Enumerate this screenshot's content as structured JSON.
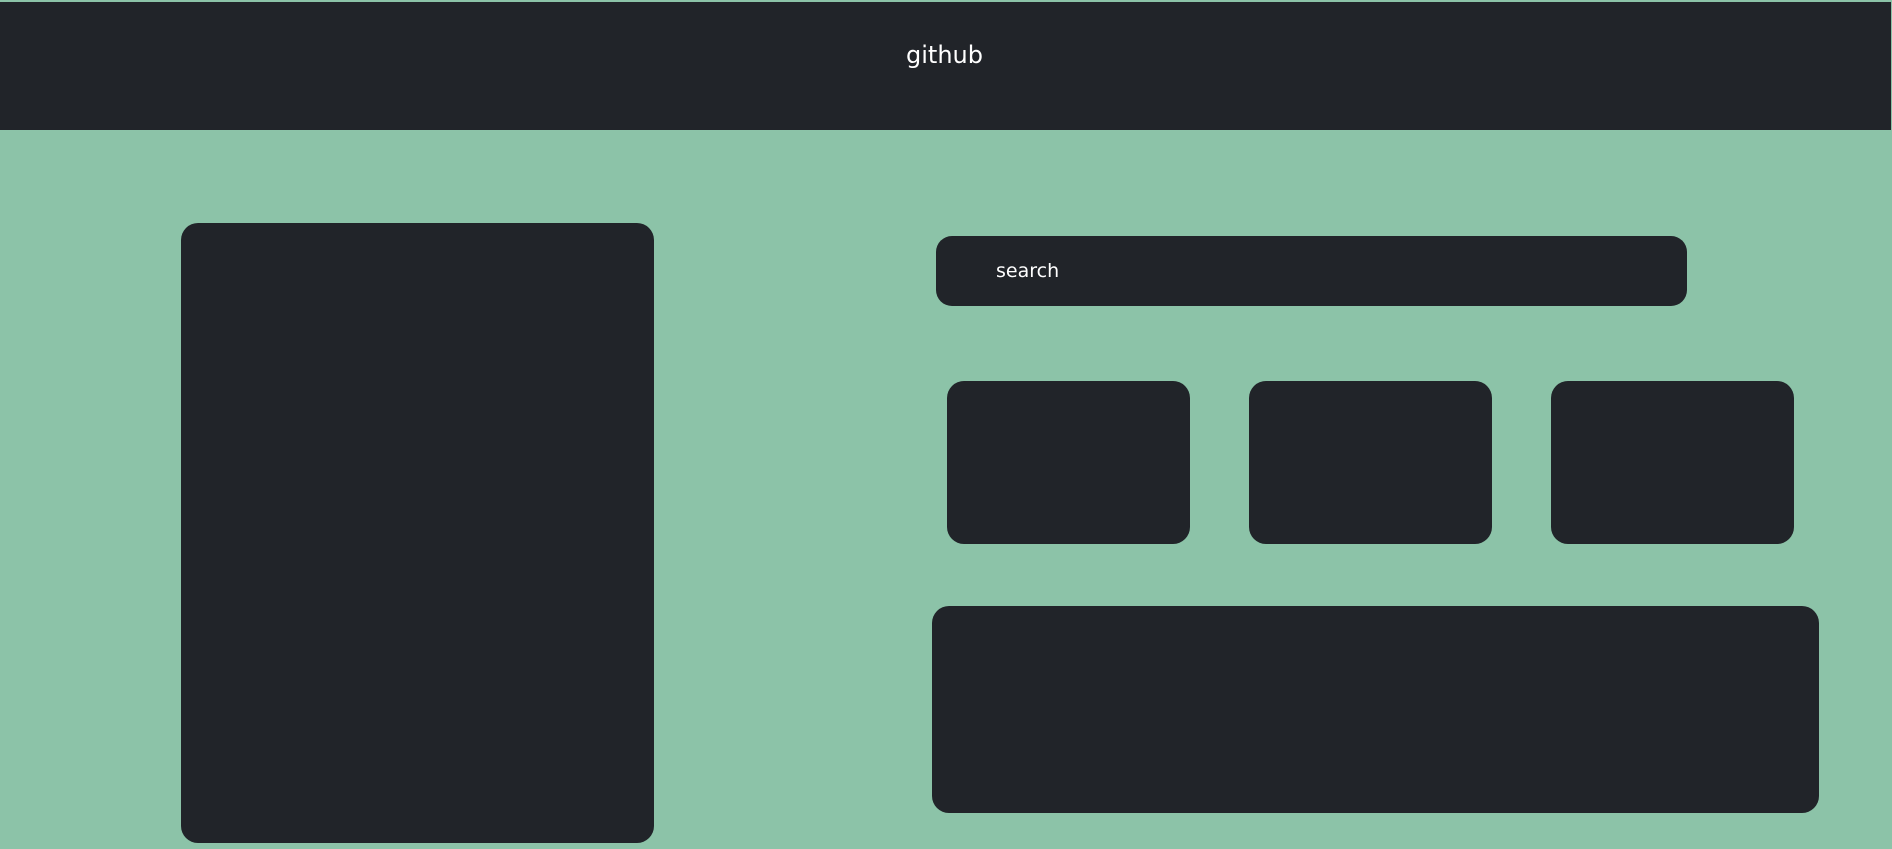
{
  "header": {
    "title": "github"
  },
  "search": {
    "placeholder": "search",
    "value": ""
  },
  "colors": {
    "background": "#8cc3a8",
    "panel": "#212429",
    "text": "#ffffff"
  }
}
